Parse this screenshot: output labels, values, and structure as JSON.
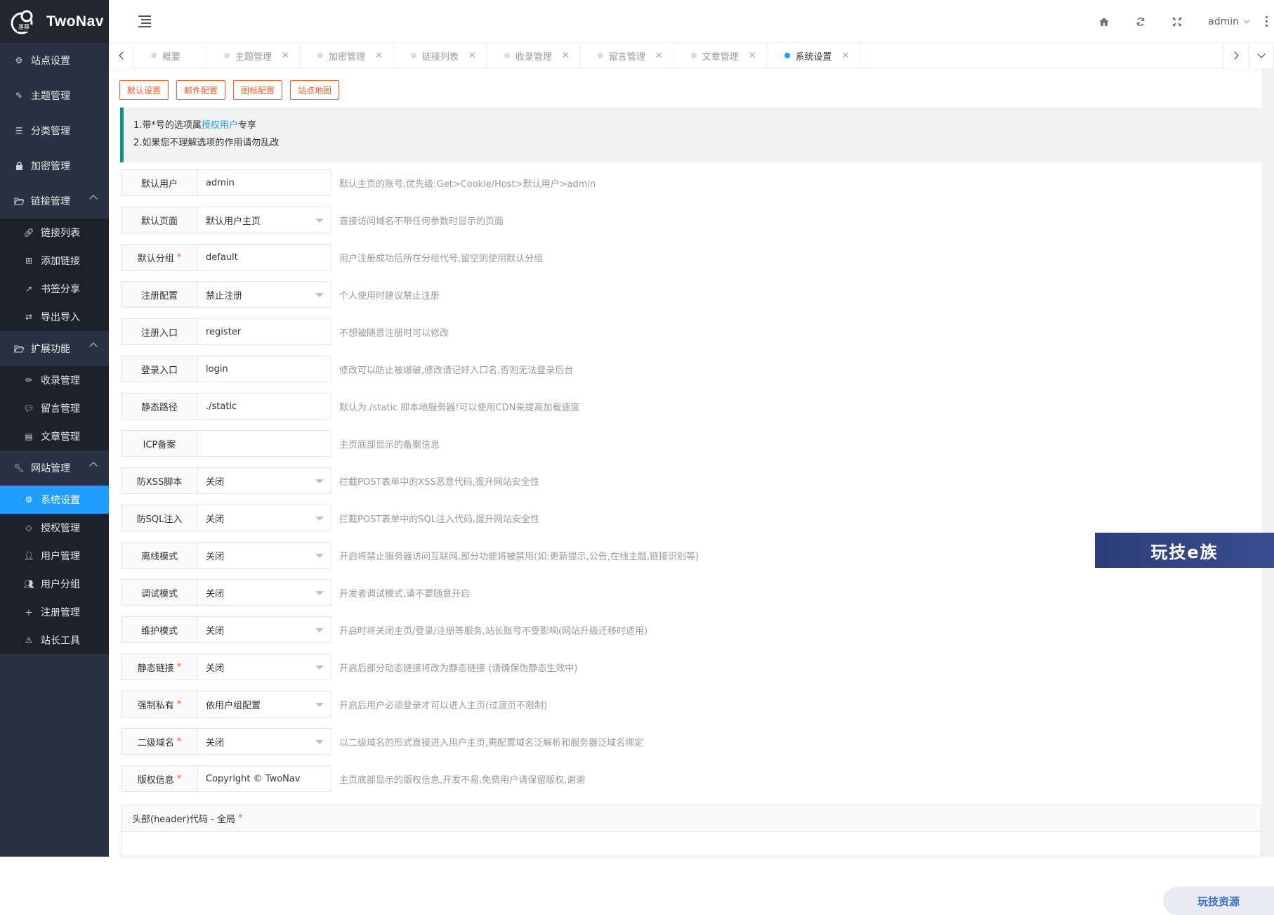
{
  "brand": {
    "name": "TwoNav",
    "logo_text": "落幕"
  },
  "sidebar": {
    "items": [
      {
        "label": "站点设置",
        "icon": "gear-icon"
      },
      {
        "label": "主题管理",
        "icon": "magic-wand-icon"
      },
      {
        "label": "分类管理",
        "icon": "list-icon"
      },
      {
        "label": "加密管理",
        "icon": "lock-icon"
      }
    ],
    "groups": [
      {
        "label": "链接管理",
        "icon": "folder-open-icon",
        "children": [
          {
            "label": "链接列表",
            "icon": "link-icon"
          },
          {
            "label": "添加链接",
            "icon": "plus-square-icon"
          },
          {
            "label": "书签分享",
            "icon": "share-icon"
          },
          {
            "label": "导出导入",
            "icon": "exchange-icon"
          }
        ]
      },
      {
        "label": "扩展功能",
        "icon": "folder-open-icon",
        "children": [
          {
            "label": "收录管理",
            "icon": "pencil-icon"
          },
          {
            "label": "留言管理",
            "icon": "comment-icon"
          },
          {
            "label": "文章管理",
            "icon": "file-icon"
          }
        ]
      },
      {
        "label": "网站管理",
        "icon": "wrench-icon",
        "children": [
          {
            "label": "系统设置",
            "icon": "gears-icon"
          },
          {
            "label": "授权管理",
            "icon": "diamond-icon"
          },
          {
            "label": "用户管理",
            "icon": "user-icon"
          },
          {
            "label": "用户分组",
            "icon": "users-icon"
          },
          {
            "label": "注册管理",
            "icon": "user-plus-icon"
          },
          {
            "label": "站长工具",
            "icon": "warning-icon"
          }
        ]
      }
    ]
  },
  "header": {
    "user": "admin"
  },
  "tabs": [
    {
      "label": "概要",
      "closable": false
    },
    {
      "label": "主题管理",
      "closable": true
    },
    {
      "label": "加密管理",
      "closable": true
    },
    {
      "label": "链接列表",
      "closable": true
    },
    {
      "label": "收录管理",
      "closable": true
    },
    {
      "label": "留言管理",
      "closable": true
    },
    {
      "label": "文章管理",
      "closable": true
    },
    {
      "label": "系统设置",
      "closable": true
    }
  ],
  "buttons": [
    "默认设置",
    "邮件配置",
    "图标配置",
    "站点地图"
  ],
  "notice": {
    "line1_pre": "1.带*号的选项属",
    "line1_link": "授权用户",
    "line1_post": "专享",
    "line2": "2.如果您不理解选项的作用请勿乱改"
  },
  "form": [
    {
      "label": "默认用户",
      "required": false,
      "type": "input",
      "value": "admin",
      "tip": "默认主页的账号,优先级:Get>Cookie/Host>默认用户>admin"
    },
    {
      "label": "默认页面",
      "required": false,
      "type": "select",
      "value": "默认用户主页",
      "tip": "直接访问域名不带任何参数时显示的页面"
    },
    {
      "label": "默认分组",
      "required": true,
      "type": "input",
      "value": "default",
      "tip": "用户注册成功后所在分组代号,留空则使用默认分组"
    },
    {
      "label": "注册配置",
      "required": false,
      "type": "select",
      "value": "禁止注册",
      "tip": "个人使用时建议禁止注册"
    },
    {
      "label": "注册入口",
      "required": false,
      "type": "input",
      "value": "register",
      "tip": "不想被随意注册时可以修改"
    },
    {
      "label": "登录入口",
      "required": false,
      "type": "input",
      "value": "login",
      "tip": "修改可以防止被爆破,修改请记好入口名,否则无法登录后台"
    },
    {
      "label": "静态路径",
      "required": false,
      "type": "input",
      "value": "./static",
      "tip": "默认为./static 即本地服务器!可以使用CDN来提高加载速度"
    },
    {
      "label": "ICP备案",
      "required": false,
      "type": "input",
      "value": "",
      "tip": "主页底部显示的备案信息"
    },
    {
      "label": "防XSS脚本",
      "required": false,
      "type": "select",
      "value": "关闭",
      "tip": "拦截POST表单中的XSS恶意代码,提升网站安全性"
    },
    {
      "label": "防SQL注入",
      "required": false,
      "type": "select",
      "value": "关闭",
      "tip": "拦截POST表单中的SQL注入代码,提升网站安全性"
    },
    {
      "label": "离线模式",
      "required": false,
      "type": "select",
      "value": "关闭",
      "tip": "开启将禁止服务器访问互联网,部分功能将被禁用(如:更新提示,公告,在线主题,链接识别等)"
    },
    {
      "label": "调试模式",
      "required": false,
      "type": "select",
      "value": "关闭",
      "tip": "开发者调试模式,请不要随意开启"
    },
    {
      "label": "维护模式",
      "required": false,
      "type": "select",
      "value": "关闭",
      "tip": "开启时将关闭主页/登录/注册等服务,站长账号不受影响(网站升级迁移时适用)"
    },
    {
      "label": "静态链接",
      "required": true,
      "type": "select",
      "value": "关闭",
      "tip": "开启后部分动态链接将改为静态链接 (请确保伪静态生效中)"
    },
    {
      "label": "强制私有",
      "required": true,
      "type": "select",
      "value": "依用户组配置",
      "tip": "开启后用户必须登录才可以进入主页(过渡页不限制)"
    },
    {
      "label": "二级域名",
      "required": true,
      "type": "select",
      "value": "关闭",
      "tip": "以二级域名的形式直接进入用户主页,需配置域名泛解析和服务器泛域名绑定"
    },
    {
      "label": "版权信息",
      "required": true,
      "type": "input",
      "value": "Copyright © TwoNav",
      "tip": "主页底部显示的版权信息,开发不易,免费用户请保留版权,谢谢"
    }
  ],
  "code_section": {
    "label": "头部(header)代码 - 全局"
  },
  "watermarks": {
    "banner": "玩技e族",
    "badge": "玩技资源"
  },
  "colors": {
    "sidebar_bg": "#2a3142",
    "active": "#1e9fff",
    "accent_orange": "#ff5722",
    "notice_border": "#009688"
  }
}
